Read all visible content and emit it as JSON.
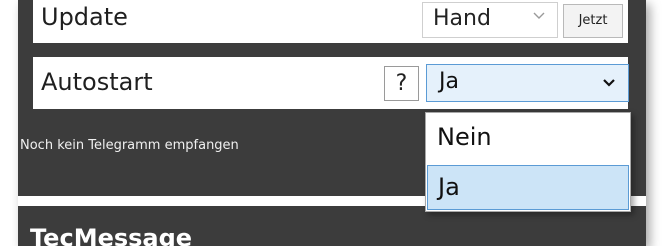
{
  "settings": {
    "update": {
      "label": "Update",
      "selected": "Hand",
      "action_label": "Jetzt"
    },
    "autostart": {
      "label": "Autostart",
      "help_label": "?",
      "selected": "Ja",
      "options": [
        "Nein",
        "Ja"
      ],
      "highlighted_option": "Ja"
    }
  },
  "status": {
    "message": "Noch kein Telegramm empfangen"
  },
  "section": {
    "title": "TecMessage"
  },
  "icons": {
    "dropdown_arrow": "chevron-down-icon"
  },
  "colors": {
    "panel_background": "#3c3c3c",
    "accent_border": "#5b9bd5",
    "selected_background": "#cce4f7"
  }
}
